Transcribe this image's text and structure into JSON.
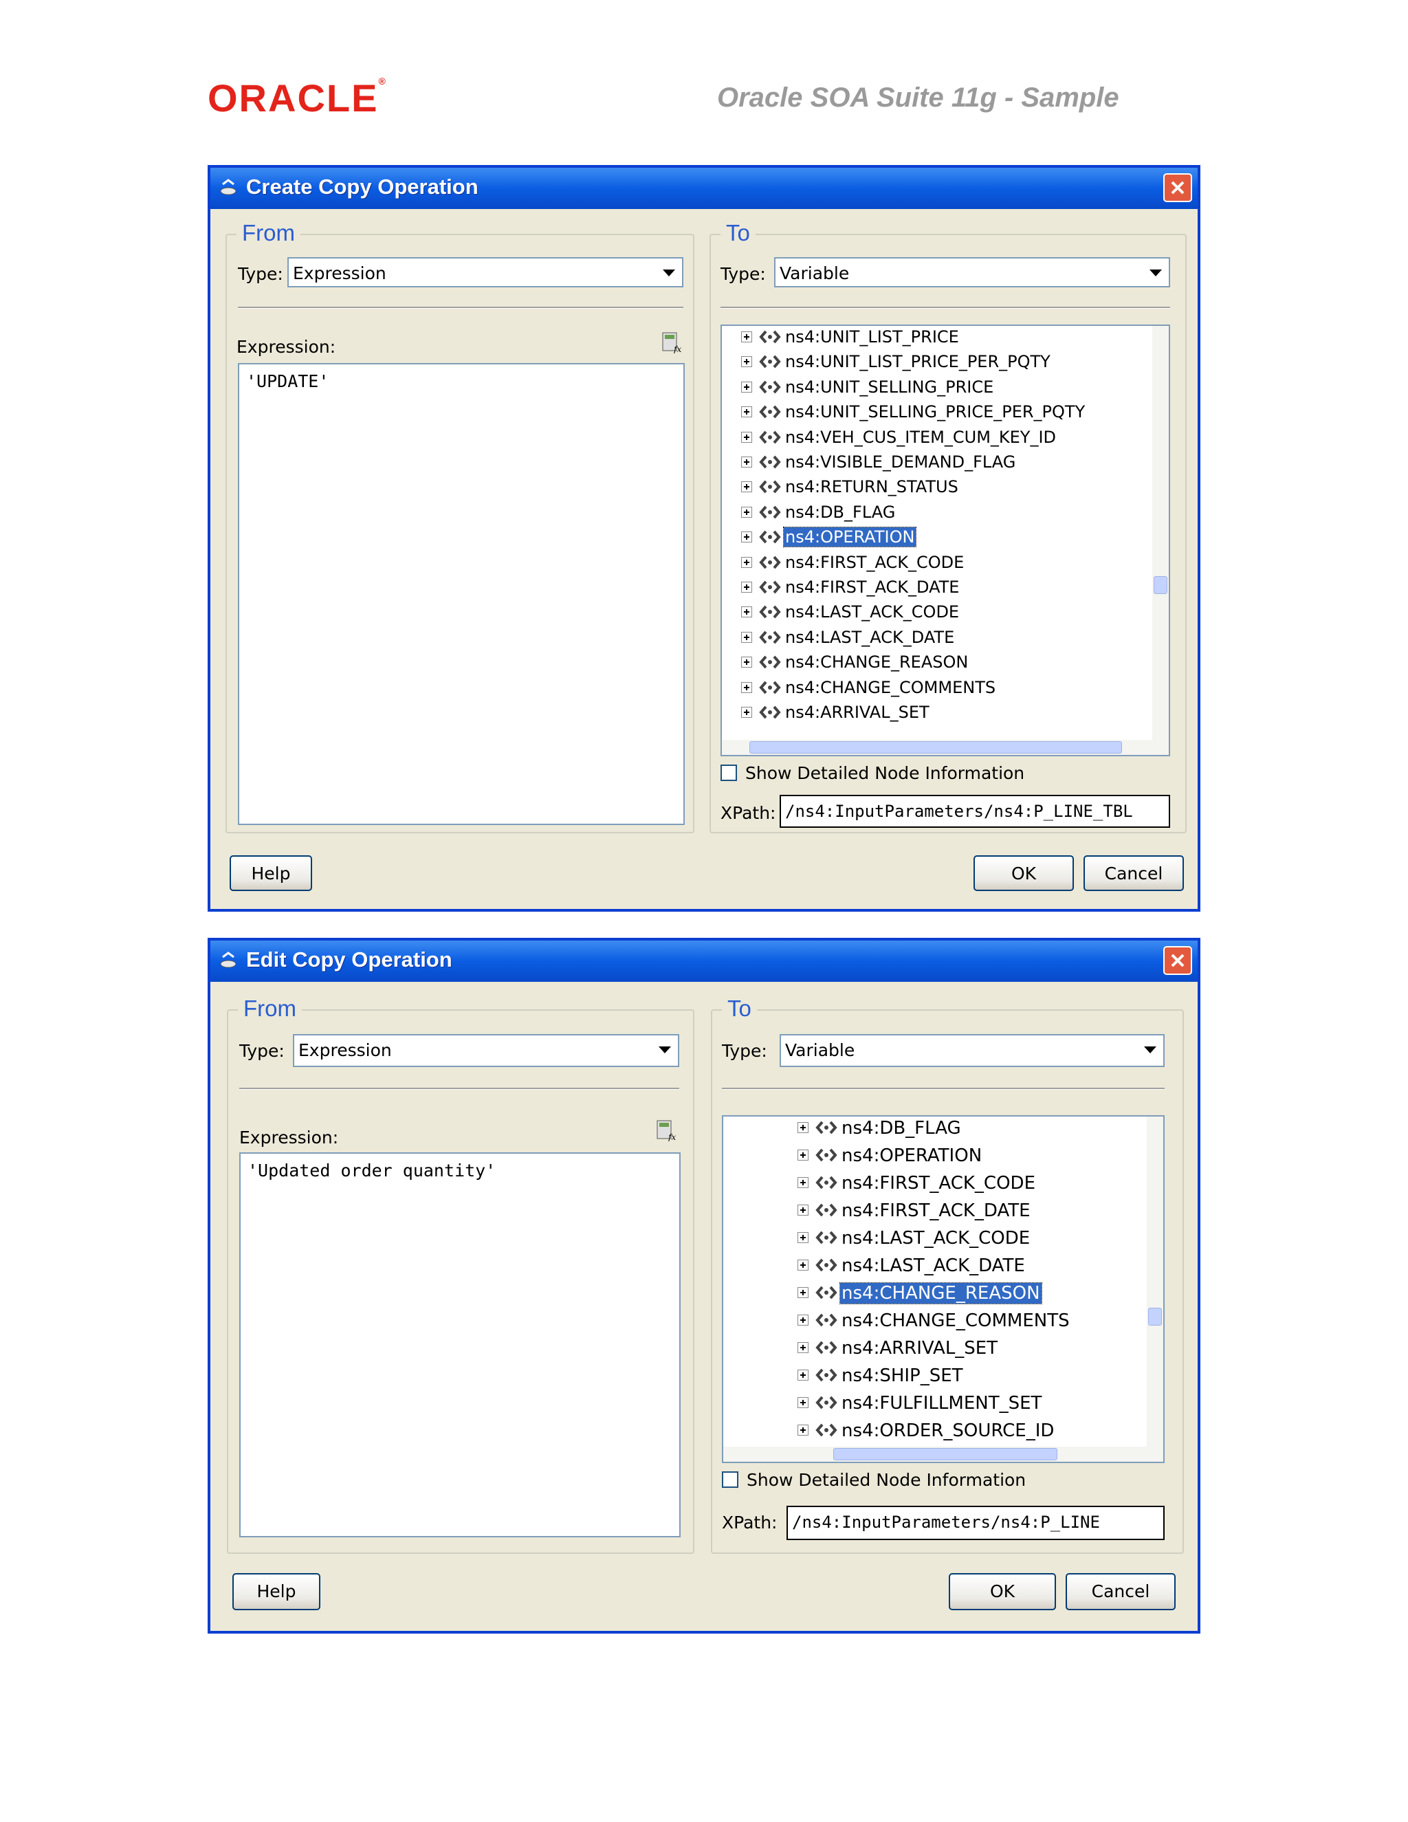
{
  "header": {
    "logo": "ORACLE",
    "title": "Oracle SOA Suite 11g - Sample"
  },
  "dialogs": [
    {
      "title": "Create Copy Operation",
      "from": {
        "label": "From",
        "type_label": "Type:",
        "type_value": "Expression",
        "expression_label": "Expression:",
        "expression_value": "'UPDATE'"
      },
      "to": {
        "label": "To",
        "type_label": "Type:",
        "type_value": "Variable",
        "nodes": [
          "ns4:UNIT_LIST_PRICE",
          "ns4:UNIT_LIST_PRICE_PER_PQTY",
          "ns4:UNIT_SELLING_PRICE",
          "ns4:UNIT_SELLING_PRICE_PER_PQTY",
          "ns4:VEH_CUS_ITEM_CUM_KEY_ID",
          "ns4:VISIBLE_DEMAND_FLAG",
          "ns4:RETURN_STATUS",
          "ns4:DB_FLAG",
          "ns4:OPERATION",
          "ns4:FIRST_ACK_CODE",
          "ns4:FIRST_ACK_DATE",
          "ns4:LAST_ACK_CODE",
          "ns4:LAST_ACK_DATE",
          "ns4:CHANGE_REASON",
          "ns4:CHANGE_COMMENTS",
          "ns4:ARRIVAL_SET"
        ],
        "selected": "ns4:OPERATION",
        "show_detail_label": "Show Detailed Node Information",
        "xpath_label": "XPath:",
        "xpath_value": "/ns4:InputParameters/ns4:P_LINE_TBL"
      },
      "buttons": {
        "help": "Help",
        "ok": "OK",
        "cancel": "Cancel"
      }
    },
    {
      "title": "Edit Copy Operation",
      "from": {
        "label": "From",
        "type_label": "Type:",
        "type_value": "Expression",
        "expression_label": "Expression:",
        "expression_value": "'Updated order quantity'"
      },
      "to": {
        "label": "To",
        "type_label": "Type:",
        "type_value": "Variable",
        "nodes": [
          "ns4:DB_FLAG",
          "ns4:OPERATION",
          "ns4:FIRST_ACK_CODE",
          "ns4:FIRST_ACK_DATE",
          "ns4:LAST_ACK_CODE",
          "ns4:LAST_ACK_DATE",
          "ns4:CHANGE_REASON",
          "ns4:CHANGE_COMMENTS",
          "ns4:ARRIVAL_SET",
          "ns4:SHIP_SET",
          "ns4:FULFILLMENT_SET",
          "ns4:ORDER_SOURCE_ID"
        ],
        "selected": "ns4:CHANGE_REASON",
        "show_detail_label": "Show Detailed Node Information",
        "xpath_label": "XPath:",
        "xpath_value": "/ns4:InputParameters/ns4:P_LINE"
      },
      "buttons": {
        "help": "Help",
        "ok": "OK",
        "cancel": "Cancel"
      }
    }
  ]
}
